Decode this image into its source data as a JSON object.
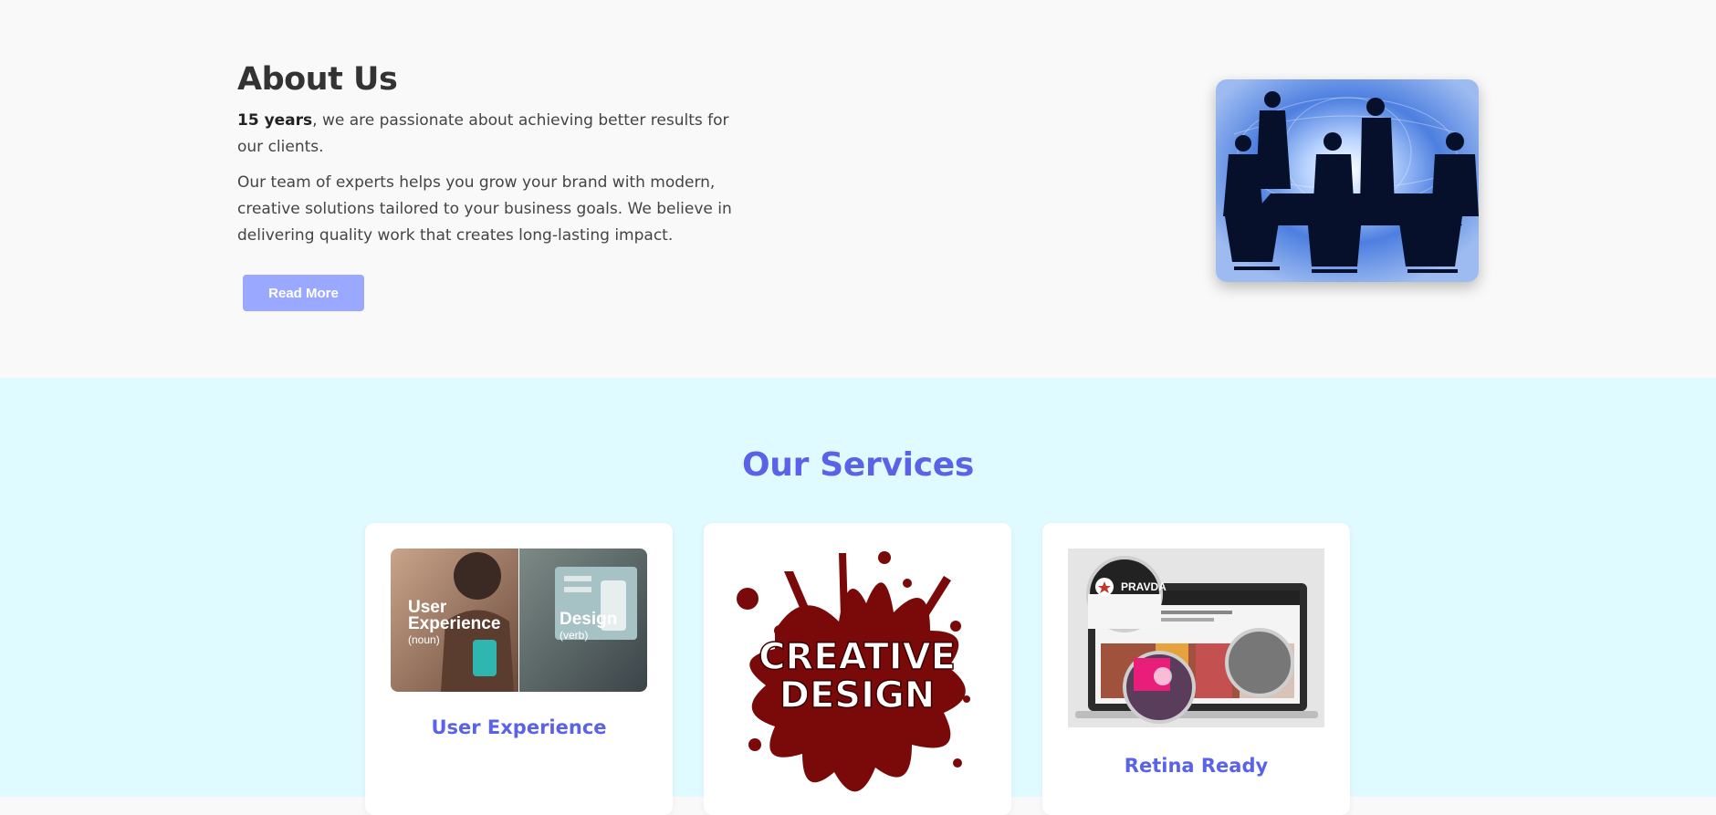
{
  "about": {
    "title": "About Us",
    "p1_bold": "15 years",
    "p1_rest": ", we are passionate about achieving better results for our clients.",
    "p2": "Our team of experts helps you grow your brand with modern, creative solutions tailored to your business goals. We believe in delivering quality work that creates long-lasting impact.",
    "button_label": "Read More"
  },
  "services": {
    "title": "Our Services",
    "cards": [
      {
        "title": "User Experience",
        "img_left_line1": "User",
        "img_left_line2": "Experience",
        "img_left_sub": "(noun)",
        "img_right_line1": "Design",
        "img_right_sub": "(verb)"
      },
      {
        "title": "",
        "img_line1": "CREATIVE",
        "img_line2": "DESIGN"
      },
      {
        "title": "Retina Ready",
        "img_brand": "PRAVDA"
      }
    ]
  },
  "colors": {
    "accent": "#5a63e8",
    "button": "#9aa9ff",
    "services_bg": "#dffbff",
    "about_bg": "#f9f9f9",
    "splash": "#7a0a0a"
  }
}
